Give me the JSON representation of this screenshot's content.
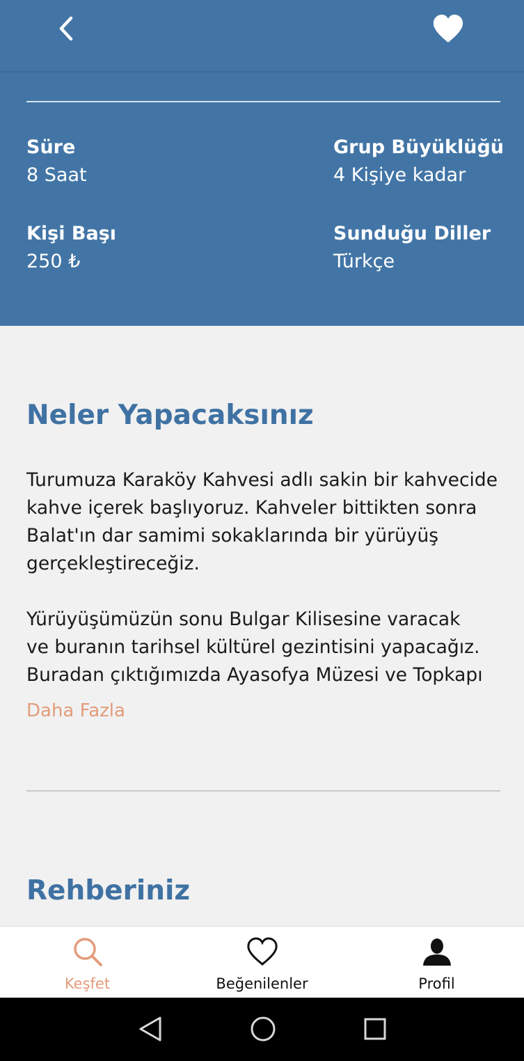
{
  "topbar": {
    "back_icon": "chevron-left-icon",
    "favorite_icon": "heart-filled-icon"
  },
  "details": {
    "duration_label": "Süre",
    "duration_value": "8 Saat",
    "group_label": "Grup Büyüklüğü",
    "group_value": "4 Kişiye kadar",
    "price_label": "Kişi Başı",
    "price_value": "250 ₺",
    "languages_label": "Sunduğu Diller",
    "languages_value": "Türkçe"
  },
  "activity": {
    "title": "Neler Yapacaksınız",
    "paragraph1": "Turumuza Karaköy Kahvesi adlı sakin bir kahvecide kahve içerek başlıyoruz. Kahveler bittikten sonra Balat'ın dar samimi sokaklarında bir yürüyüş gerçekleştireceğiz.",
    "paragraph2_line1": "Yürüyüşümüzün sonu Bulgar Kilisesine varacak",
    "paragraph2_line2": "ve buranın tarihsel kültürel gezintisini yapacağız.",
    "paragraph2_line3": "Buradan çıktığımızda Ayasofya Müzesi ve Topkapı",
    "more_label": "Daha Fazla"
  },
  "guide": {
    "title": "Rehberiniz"
  },
  "bottom_nav": {
    "items": [
      {
        "label": "Keşfet",
        "icon": "search-icon",
        "active": true
      },
      {
        "label": "Beğenilenler",
        "icon": "heart-outline-icon",
        "active": false
      },
      {
        "label": "Profil",
        "icon": "user-icon",
        "active": false
      }
    ]
  },
  "system_nav": {
    "back_icon": "triangle-back-icon",
    "home_icon": "circle-home-icon",
    "recents_icon": "square-recents-icon"
  },
  "colors": {
    "primary": "#4275a6",
    "accent": "#e39c7c",
    "background": "#f1f1f1"
  }
}
